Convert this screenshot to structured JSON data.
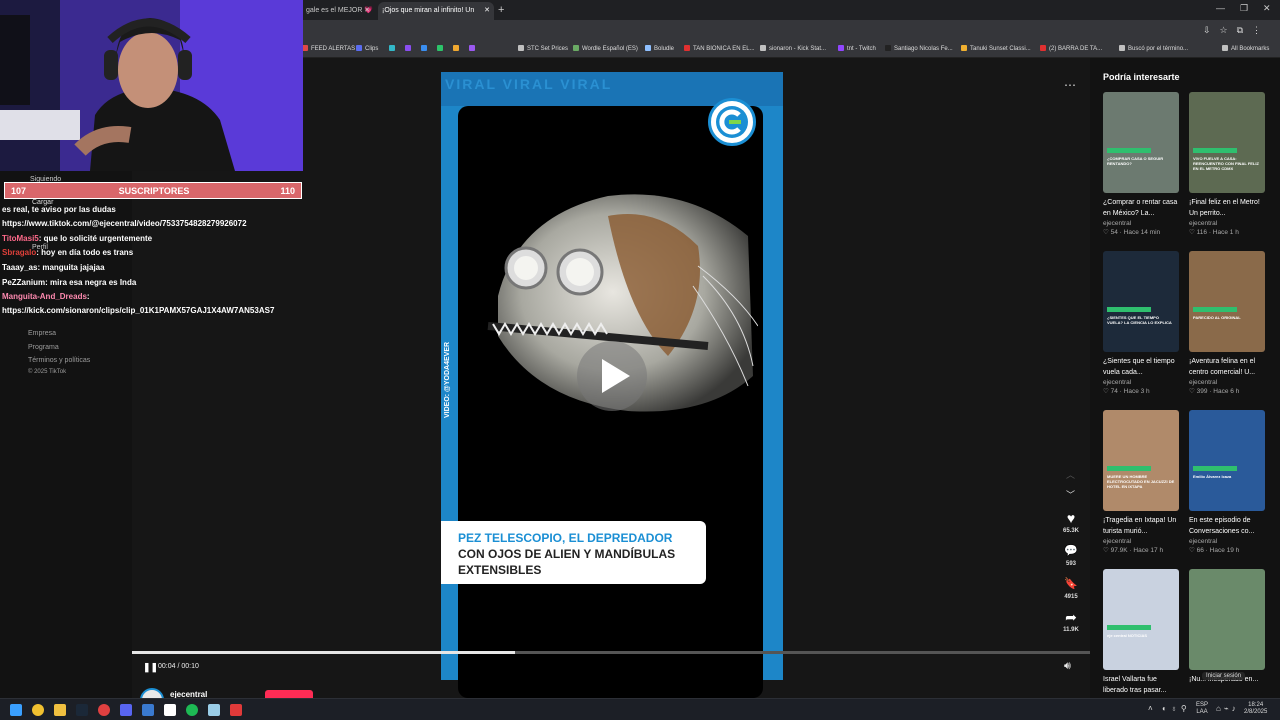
{
  "browser": {
    "tabs": [
      {
        "label": "gale es el MEJOR 💗",
        "active": false
      },
      {
        "label": "¡Ojos que miran al infinito! Un",
        "active": true
      }
    ],
    "new_tab": "+",
    "bookmarks": [
      {
        "label": "FEED ALERTAS",
        "color": "#e04848"
      },
      {
        "label": "Clips",
        "color": "#5a6cf0"
      },
      {
        "label": "",
        "color": "#33b8c8"
      },
      {
        "label": "",
        "color": "#8a4ef0"
      },
      {
        "label": "",
        "color": "#3a8ef0"
      },
      {
        "label": "",
        "color": "#2cc46a"
      },
      {
        "label": "",
        "color": "#f0a830"
      },
      {
        "label": "",
        "color": "#9b59f0"
      },
      {
        "label": "STC Set Prices",
        "color": "#c0c0c0"
      },
      {
        "label": "Wordle Español (ES)",
        "color": "#6aaa64"
      },
      {
        "label": "Boludle",
        "color": "#8fc0ff"
      },
      {
        "label": "TAN BIONICA EN EL...",
        "color": "#e03030"
      },
      {
        "label": "sionaron - Kick Stat...",
        "color": "#c0c0c0"
      },
      {
        "label": "tnt - Twitch",
        "color": "#9146ff"
      },
      {
        "label": "Santiago Nicolas Fe...",
        "color": "#222222"
      },
      {
        "label": "Tanuki Sunset Classi...",
        "color": "#f0b030"
      },
      {
        "label": "(2) BARRA DE TA...",
        "color": "#e03030"
      },
      {
        "label": "Buscó por el término...",
        "color": "#c0c0c0"
      },
      {
        "label": "All Bookmarks",
        "color": "#c0c0c0"
      }
    ]
  },
  "stream": {
    "sub_bar": {
      "left": "107",
      "label": "SUSCRIPTORES",
      "right": "110"
    },
    "under_bar_text": "Siguiendo",
    "cargar": "Cargar",
    "perfil": "Perfil",
    "chat": [
      {
        "nick": "",
        "nick_color": "#ffffff",
        "text": "es real, te aviso por las dudas"
      },
      {
        "nick": "",
        "nick_color": "#ffffff",
        "text": "https://www.tiktok.com/@ejecentral/video/7533754828279926072"
      },
      {
        "nick": "TitoMasi5",
        "nick_color": "#ff6a8a",
        "text": ": que lo solicité urgentemente"
      },
      {
        "nick": "Sbragalo",
        "nick_color": "#e0403a",
        "text": ": hoy en día todo es trans"
      },
      {
        "nick": "Taaay_as",
        "nick_color": "#ffffff",
        "text": ": manguita jajajaa"
      },
      {
        "nick": "PeZZanium",
        "nick_color": "#ffffff",
        "text": ": mira esa negra es Inda"
      },
      {
        "nick": "Manguita-And_Dreads",
        "nick_color": "#ff8ab0",
        "text": ":"
      },
      {
        "nick": "",
        "nick_color": "#ffffff",
        "text": "https://kick.com/sionaron/clips/clip_01K1PAMX57GAJ1X4AW7AN53AS7"
      }
    ]
  },
  "leftnav": {
    "footer": [
      "Empresa",
      "Programa",
      "Términos y políticas",
      "© 2025 TikTok"
    ]
  },
  "video": {
    "top_text": "VIRAL VIRAL VIRAL",
    "credit": "VIDEO: @YODA4EVER",
    "caption_line1": "PEZ TELESCOPIO, EL DEPREDADOR",
    "caption_line2": "CON OJOS DE ALIEN Y MANDÍBULAS",
    "caption_line3": "EXTENSIBLES",
    "time": "00:04 / 00:10",
    "progress": 0.4,
    "author": "ejecentral"
  },
  "actions": [
    {
      "icon": "heart-icon",
      "glyph": "♥",
      "count": "65.3K"
    },
    {
      "icon": "comment-icon",
      "glyph": "💬",
      "count": "593"
    },
    {
      "icon": "bookmark-icon",
      "glyph": "🔖",
      "count": "4915"
    },
    {
      "icon": "share-icon",
      "glyph": "➦",
      "count": "11.9K"
    }
  ],
  "rail": {
    "title": "Podría interesarte",
    "cards": [
      {
        "title": "¿Comprar o rentar casa en México? La...",
        "author": "ejecentral",
        "likes": "54",
        "ago": "Hace 14 min",
        "thumb": "#6c7a70",
        "thumb_text": "¿COMPRAR CASA O SEGUIR RENTANDO?"
      },
      {
        "title": "¡Final feliz en el Metro! Un perrito...",
        "author": "ejecentral",
        "likes": "116",
        "ago": "Hace 1 h",
        "thumb": "#5d6a52",
        "thumb_text": "VIVO FUELVE A CASA: REENCUENTRO CON FINAL FELIZ EN EL METRO CDMX"
      },
      {
        "title": "¿Sientes que el tiempo vuela cada...",
        "author": "ejecentral",
        "likes": "74",
        "ago": "Hace 3 h",
        "thumb": "#1d2a3a",
        "thumb_text": "¿SIENTES QUE EL TIEMPO VUELA? LA CIENCIA LO EXPLICA"
      },
      {
        "title": "¡Aventura felina en el centro comercial! U...",
        "author": "ejecentral",
        "likes": "399",
        "ago": "Hace 6 h",
        "thumb": "#8a6a4a",
        "thumb_text": "PARECIDO AL ORIGINAL"
      },
      {
        "title": "¡Tragedia en Ixtapa! Un turista murió...",
        "author": "ejecentral",
        "likes": "97.9K",
        "ago": "Hace 17 h",
        "thumb": "#b08a6a",
        "thumb_text": "MUERE UN HOMBRE ELECTROCUTADO EN JACUZZI DE HOTEL EN IXTAPA"
      },
      {
        "title": "En este episodio de Conversaciones co...",
        "author": "ejecentral",
        "likes": "66",
        "ago": "Hace 19 h",
        "thumb": "#2a5a9a",
        "thumb_text": "Emilio Álvarez Icaza"
      },
      {
        "title": "Israel Vallarta fue liberado tras pasar...",
        "author": "",
        "likes": "",
        "ago": "",
        "thumb": "#c9d2e0",
        "thumb_text": "eje central NOTICIAS"
      },
      {
        "title": "¡Nu... inesperado en...",
        "author": "",
        "likes": "",
        "ago": "",
        "thumb": "#6a8a6a",
        "thumb_text": ""
      }
    ],
    "start_session": "Iniciar sesión"
  },
  "taskbar": {
    "lang_top": "ESP",
    "lang_bottom": "LAA",
    "time": "18:24",
    "date": "2/8/2025"
  }
}
